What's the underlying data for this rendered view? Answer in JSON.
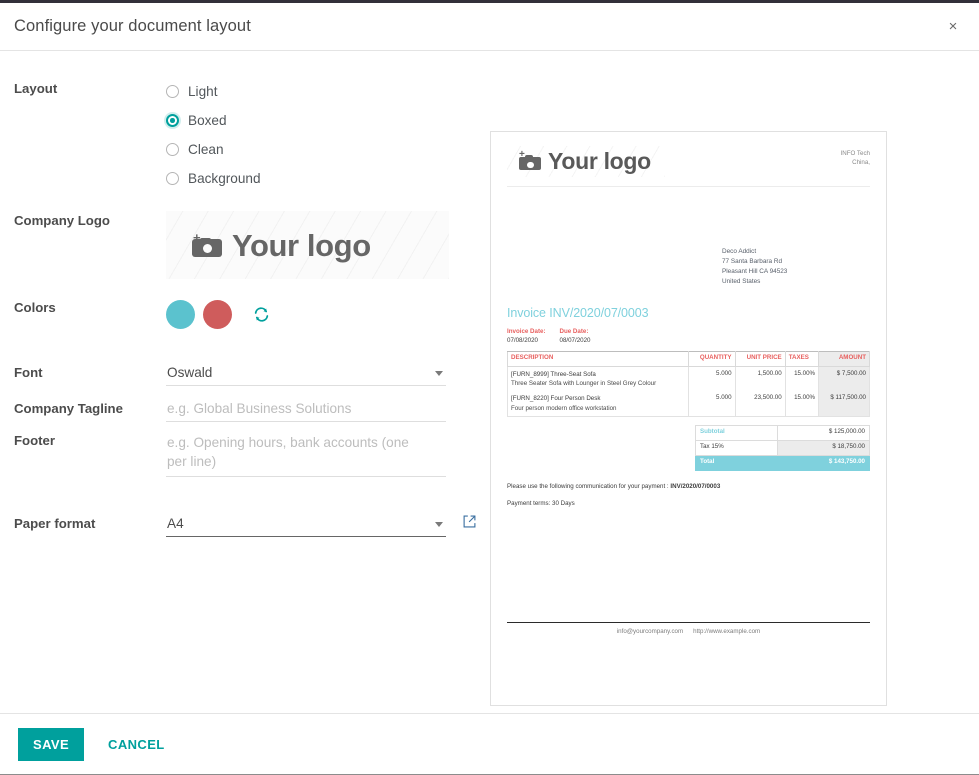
{
  "dialog": {
    "title": "Configure your document layout",
    "close_label": "×"
  },
  "form": {
    "layout": {
      "label": "Layout",
      "options": [
        {
          "label": "Light",
          "selected": false
        },
        {
          "label": "Boxed",
          "selected": true
        },
        {
          "label": "Clean",
          "selected": false
        },
        {
          "label": "Background",
          "selected": false
        }
      ]
    },
    "company_logo": {
      "label": "Company Logo",
      "placeholder_text": "Your logo"
    },
    "colors": {
      "label": "Colors",
      "primary": "#5bc2ce",
      "secondary": "#cf5c5c",
      "reset_title": "Reset colors"
    },
    "font": {
      "label": "Font",
      "value": "Oswald"
    },
    "company_tagline": {
      "label": "Company Tagline",
      "value": "",
      "placeholder": "e.g. Global Business Solutions"
    },
    "footer": {
      "label": "Footer",
      "value": "",
      "placeholder": "e.g. Opening hours, bank accounts (one per line)"
    },
    "paper_format": {
      "label": "Paper format",
      "value": "A4"
    }
  },
  "preview": {
    "logo_text": "Your logo",
    "company_lines": [
      "INFO Tech",
      "China,"
    ],
    "customer_address": [
      "Deco Addict",
      "77 Santa Barbara Rd",
      "Pleasant Hill CA 94523",
      "United States"
    ],
    "invoice_title": "Invoice INV/2020/07/0003",
    "dates": [
      {
        "label": "Invoice Date:",
        "value": "07/08/2020"
      },
      {
        "label": "Due Date:",
        "value": "08/07/2020"
      }
    ],
    "table": {
      "headers": [
        "DESCRIPTION",
        "QUANTITY",
        "UNIT PRICE",
        "TAXES",
        "AMOUNT"
      ],
      "rows": [
        {
          "description": "[FURN_8999] Three-Seat Sofa",
          "sub_description": "Three Seater Sofa with Lounger in Steel Grey Colour",
          "quantity": "5.000",
          "unit_price": "1,500.00",
          "taxes": "15.00%",
          "amount": "$ 7,500.00"
        },
        {
          "description": "[FURN_8220] Four Person Desk",
          "sub_description": "Four person modern office workstation",
          "quantity": "5.000",
          "unit_price": "23,500.00",
          "taxes": "15.00%",
          "amount": "$ 117,500.00"
        }
      ]
    },
    "totals": [
      {
        "label": "Subtotal",
        "value": "$ 125,000.00"
      },
      {
        "label": "Tax 15%",
        "value": "$ 18,750.00"
      },
      {
        "label": "Total",
        "value": "$ 143,750.00"
      }
    ],
    "payment_note_prefix": "Please use the following communication for your payment : ",
    "payment_note_ref": "INV/2020/07/0003",
    "payment_terms": "Payment terms: 30 Days",
    "footer_email": "info@yourcompany.com",
    "footer_website": "http://www.example.com"
  },
  "footer_buttons": {
    "save": "SAVE",
    "cancel": "CANCEL"
  }
}
